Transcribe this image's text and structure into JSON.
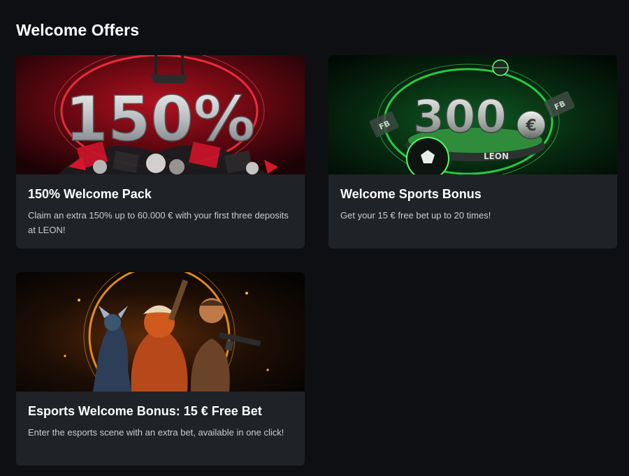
{
  "page": {
    "title": "Welcome Offers"
  },
  "offers": [
    {
      "title": "150% Welcome Pack",
      "description": "Claim an extra 150% up to 60.000 € with your first three deposits at LEON!",
      "image_text": "150%",
      "image_icon": "gift-pile-icon"
    },
    {
      "title": "Welcome Sports Bonus",
      "description": "Get your 15 € free bet up to 20 times!",
      "image_text": "300",
      "image_currency": "€",
      "image_brand": "LEON",
      "image_badge": "FB",
      "image_icon": "soccer-ball-icon"
    },
    {
      "title": "Esports Welcome Bonus: 15 € Free Bet",
      "description": "Enter the esports scene with an extra bet, available in one click!",
      "image_icon": "esports-heroes-icon"
    }
  ],
  "colors": {
    "background": "#0d0f12",
    "card": "#1f2327",
    "text": "#ffffff",
    "muted": "#c9cdd1",
    "red_accent": "#e0182d",
    "green_accent": "#2bd94a",
    "orange_accent": "#f59a1c"
  }
}
